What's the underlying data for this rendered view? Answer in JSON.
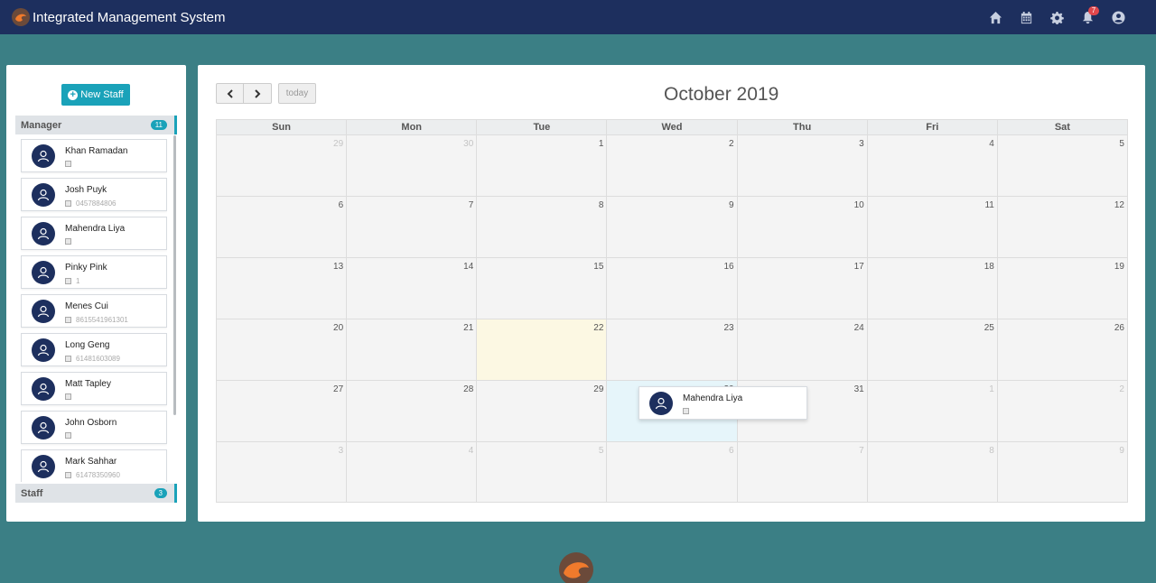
{
  "app": {
    "title": "Integrated Management System",
    "notification_count": "7",
    "nav_icons": [
      "home-icon",
      "calendar-icon",
      "gear-icon",
      "bell-icon",
      "user-circle-icon"
    ]
  },
  "colors": {
    "navbar": "#1d2f5e",
    "background": "#3b7f85",
    "accent": "#1aa2b9",
    "today": "#fcf8e3",
    "highlight": "#e6f5fa"
  },
  "sidebar": {
    "new_staff_label": "New Staff",
    "manager_group": {
      "label": "Manager",
      "count": "11"
    },
    "staff_group": {
      "label": "Staff",
      "count": "3"
    },
    "managers": [
      {
        "name": "Khan Ramadan",
        "phone": ""
      },
      {
        "name": "Josh Puyk",
        "phone": "0457884806"
      },
      {
        "name": "Mahendra Liya",
        "phone": ""
      },
      {
        "name": "Pinky Pink",
        "phone": "1"
      },
      {
        "name": "Menes Cui",
        "phone": "8615541961301"
      },
      {
        "name": "Long Geng",
        "phone": "61481603089"
      },
      {
        "name": "Matt Tapley",
        "phone": ""
      },
      {
        "name": "John Osborn",
        "phone": ""
      },
      {
        "name": "Mark Sahhar",
        "phone": "61478350960"
      }
    ]
  },
  "calendar": {
    "title": "October 2019",
    "today_label": "today",
    "days_of_week": [
      "Sun",
      "Mon",
      "Tue",
      "Wed",
      "Thu",
      "Fri",
      "Sat"
    ],
    "weeks": [
      [
        "29",
        "30",
        "1",
        "2",
        "3",
        "4",
        "5"
      ],
      [
        "6",
        "7",
        "8",
        "9",
        "10",
        "11",
        "12"
      ],
      [
        "13",
        "14",
        "15",
        "16",
        "17",
        "18",
        "19"
      ],
      [
        "20",
        "21",
        "22",
        "23",
        "24",
        "25",
        "26"
      ],
      [
        "27",
        "28",
        "29",
        "30",
        "31",
        "1",
        "2"
      ],
      [
        "3",
        "4",
        "5",
        "6",
        "7",
        "8",
        "9"
      ]
    ],
    "dragging_card": {
      "name": "Mahendra Liya",
      "phone": ""
    }
  }
}
